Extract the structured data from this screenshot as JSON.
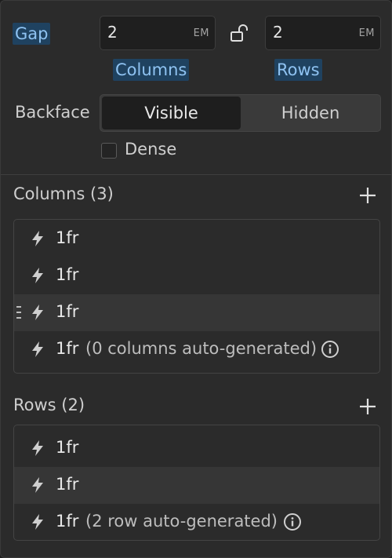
{
  "gap": {
    "label": "Gap",
    "columns": {
      "value": "2",
      "unit": "EM",
      "label": "Columns"
    },
    "rows": {
      "value": "2",
      "unit": "EM",
      "label": "Rows"
    },
    "lock_icon": "unlock-icon"
  },
  "backface": {
    "label": "Backface",
    "options": [
      "Visible",
      "Hidden"
    ],
    "selected": "Visible"
  },
  "dense": {
    "label": "Dense",
    "checked": false
  },
  "columns_section": {
    "title": "Columns (3)",
    "items": [
      {
        "value": "1fr",
        "note": ""
      },
      {
        "value": "1fr",
        "note": ""
      },
      {
        "value": "1fr",
        "note": ""
      },
      {
        "value": "1fr",
        "note": "(0 columns auto-generated)"
      }
    ]
  },
  "rows_section": {
    "title": "Rows (2)",
    "items": [
      {
        "value": "1fr",
        "note": ""
      },
      {
        "value": "1fr",
        "note": ""
      },
      {
        "value": "1fr",
        "note": "(2 row auto-generated)"
      }
    ]
  },
  "colors": {
    "accent_label_bg": "#1f4260",
    "accent_label_text": "#8fc3f2",
    "panel_bg": "#2b2b2b"
  }
}
